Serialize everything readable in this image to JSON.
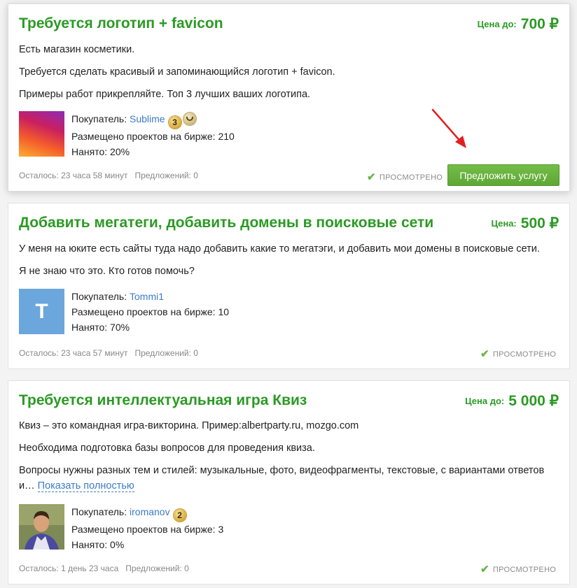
{
  "price_label_first": "Цена до:",
  "price_label_second": "Цена:",
  "currency": "₽",
  "buyer_label": "Покупатель:",
  "viewed_label": "ПРОСМОТРЕНО",
  "offer_button": "Предложить услугу",
  "projects": [
    {
      "title": "Требуется логотип + favicon",
      "price_label": "Цена до:",
      "price": "700 ₽",
      "description": [
        "Есть магазин косметики.",
        "Требуется сделать красивый и запоминающийся логотип + favicon.",
        "Примеры работ прикрепляйте. Топ 3 лучших ваших логотипа."
      ],
      "buyer": "Sublime",
      "buyer_level": "3",
      "projects_posted": "Размещено проектов на бирже: 210",
      "hired": "Нанято: 20%",
      "time_left": "Осталось: 23 часа 58 минут",
      "offers": "Предложений: 0"
    },
    {
      "title": "Добавить мегатеги, добавить домены в поисковые сети",
      "price_label": "Цена:",
      "price": "500 ₽",
      "description": [
        "У меня на юките есть сайты туда надо добавить какие то мегатэги, и добавить мои домены в поисковые сети.",
        "Я не знаю что это. Кто готов помочь?"
      ],
      "buyer": "Tommi1",
      "avatar_letter": "T",
      "projects_posted": "Размещено проектов на бирже: 10",
      "hired": "Нанято: 70%",
      "time_left": "Осталось: 23 часа 57 минут",
      "offers": "Предложений: 0"
    },
    {
      "title": "Требуется интеллектуальная игра Квиз",
      "price_label": "Цена до:",
      "price": "5 000 ₽",
      "description": [
        "Квиз – это командная игра-викторина. Пример:albertparty.ru, mozgo.com",
        "Необходима подготовка базы вопросов для проведения квиза.",
        "Вопросы нужны разных тем и стилей: музыкальные, фото, видеофрагменты, текстовые, с вариантами ответов и…"
      ],
      "show_more": "Показать полностью",
      "buyer": "iromanov",
      "buyer_level": "2",
      "projects_posted": "Размещено проектов на бирже: 3",
      "hired": "Нанято: 0%",
      "time_left": "Осталось: 1 день 23 часа",
      "offers": "Предложений: 0"
    }
  ],
  "colors": {
    "title_green": "#2b9a24",
    "link_blue": "#3b7bc8",
    "button_green": "#5ea736",
    "arrow_red": "#e02020"
  }
}
